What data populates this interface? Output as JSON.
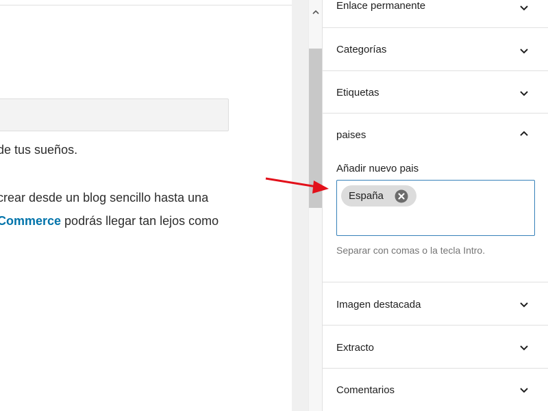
{
  "editor": {
    "paragraph_line1": "de tus sueños.",
    "paragraph_line2": "crear desde un blog sencillo hasta una",
    "paragraph_link": "Commerce",
    "paragraph_line3_rest": " podrás llegar tan lejos como"
  },
  "sidebar": {
    "panels": [
      {
        "label": "Enlace permanente",
        "state": "collapsed"
      },
      {
        "label": "Categorías",
        "state": "collapsed"
      },
      {
        "label": "Etiquetas",
        "state": "collapsed"
      },
      {
        "label": "paises",
        "state": "expanded"
      },
      {
        "label": "Imagen destacada",
        "state": "collapsed"
      },
      {
        "label": "Extracto",
        "state": "collapsed"
      },
      {
        "label": "Comentarios",
        "state": "collapsed"
      }
    ],
    "paises": {
      "field_label": "Añadir nuevo pais",
      "tokens": [
        "España"
      ],
      "help_text": "Separar con comas o la tecla Intro."
    }
  },
  "icons": {
    "chevron": "chevron-down-icon",
    "chevron_open": "chevron-up-icon",
    "remove": "remove-token-icon",
    "annotation": "red-arrow"
  },
  "colors": {
    "accent": "#3580b9",
    "link": "#0073aa",
    "arrow": "#e2101a"
  }
}
